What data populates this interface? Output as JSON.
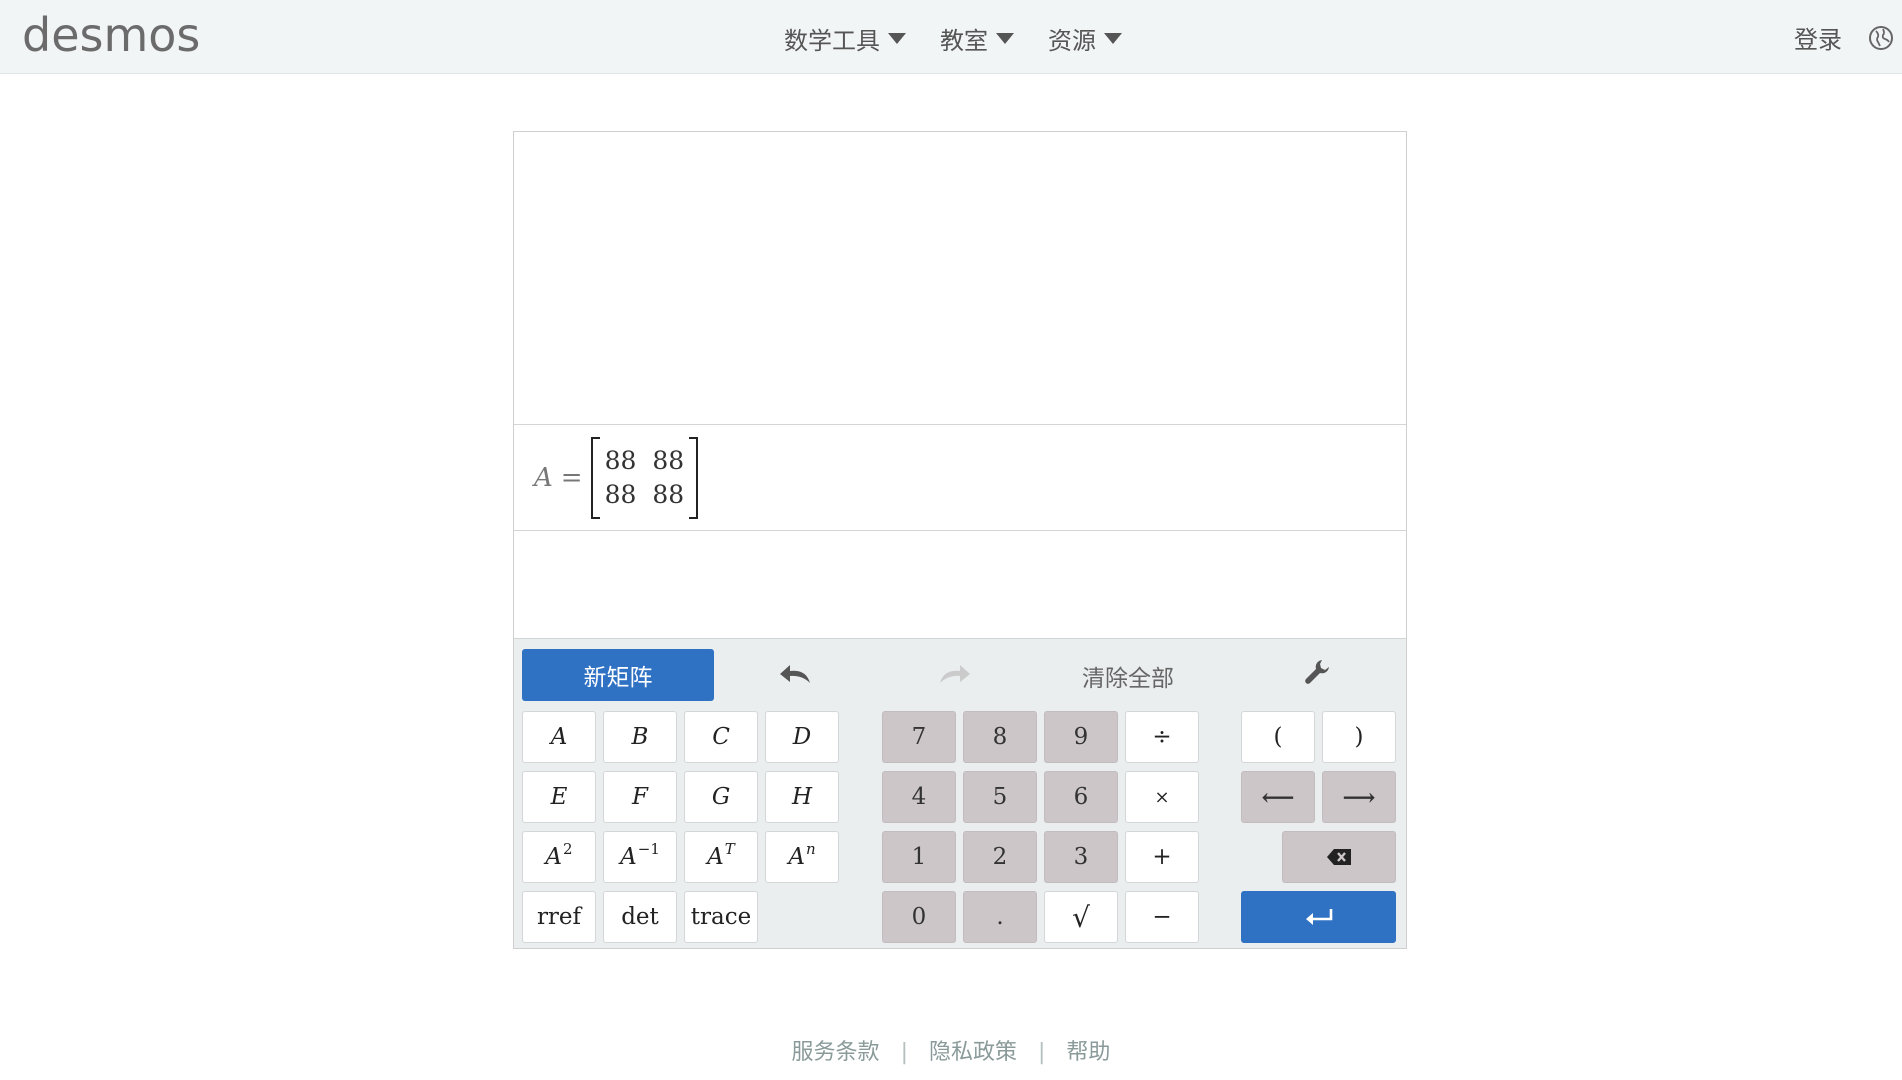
{
  "header": {
    "logo": "desmos",
    "nav": [
      {
        "label": "数学工具"
      },
      {
        "label": "教室"
      },
      {
        "label": "资源"
      }
    ],
    "login_label": "登录",
    "icons": {
      "caret": "caret-down-icon",
      "globe": "globe-icon"
    }
  },
  "expression": {
    "variable": "A",
    "equals": "=",
    "matrix": [
      [
        "88",
        "88"
      ],
      [
        "88",
        "88"
      ]
    ]
  },
  "keypad": {
    "new_matrix_label": "新矩阵",
    "clear_all_label": "清除全部",
    "icons": {
      "undo": "undo-icon",
      "redo": "redo-icon",
      "settings": "wrench-icon",
      "backspace": "backspace-icon",
      "enter": "enter-icon"
    },
    "matrix_keys": [
      "A",
      "B",
      "C",
      "D",
      "E",
      "F",
      "G",
      "H"
    ],
    "power_keys": [
      {
        "base": "A",
        "sup": "2"
      },
      {
        "base": "A",
        "sup": "−1"
      },
      {
        "base": "A",
        "sup": "T"
      },
      {
        "base": "A",
        "sup": "n"
      }
    ],
    "function_keys": [
      "rref",
      "det",
      "trace"
    ],
    "number_keys": [
      "7",
      "8",
      "9",
      "4",
      "5",
      "6",
      "1",
      "2",
      "3",
      "0",
      "."
    ],
    "operator_keys": [
      "÷",
      "×",
      "+",
      "−"
    ],
    "sqrt_key": "√",
    "paren_keys": [
      "(",
      ")"
    ],
    "arrow_keys": [
      "⟵",
      "⟶"
    ]
  },
  "footer": {
    "links": [
      "服务条款",
      "隐私政策",
      "帮助"
    ],
    "separator": "|"
  },
  "colors": {
    "accent": "#2f72c4",
    "header_bg": "#f2f5f5",
    "numkey_bg": "#ccc6c8",
    "keypad_bg": "#ebeeee"
  }
}
